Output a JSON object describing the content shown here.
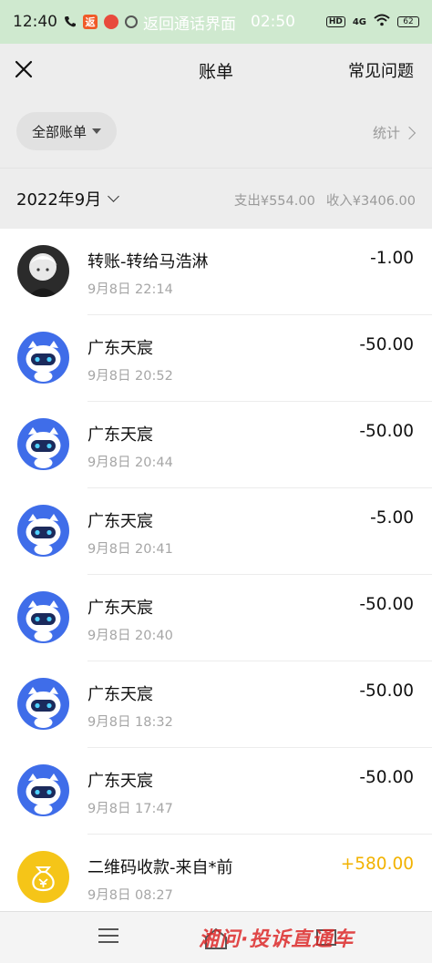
{
  "status_bar": {
    "time": "12:40",
    "call_back_text": "返回通话界面",
    "call_duration": "02:50",
    "app_badge": "返",
    "hd_label": "HD",
    "network": "4G",
    "battery": "62"
  },
  "header": {
    "title": "账单",
    "faq_label": "常见问题"
  },
  "filter": {
    "all_bills_label": "全部账单",
    "stats_label": "统计"
  },
  "month": {
    "label": "2022年9月",
    "expense": "支出¥554.00",
    "income": "收入¥3406.00"
  },
  "transactions": [
    {
      "name": "转账-转给马浩淋",
      "time": "9月8日 22:14",
      "amount": "-1.00",
      "avatar": "person-avatar",
      "type": "expense"
    },
    {
      "name": "广东天宸",
      "time": "9月8日 20:52",
      "amount": "-50.00",
      "avatar": "robot-avatar",
      "type": "expense"
    },
    {
      "name": "广东天宸",
      "time": "9月8日 20:44",
      "amount": "-50.00",
      "avatar": "robot-avatar",
      "type": "expense"
    },
    {
      "name": "广东天宸",
      "time": "9月8日 20:41",
      "amount": "-5.00",
      "avatar": "robot-avatar",
      "type": "expense"
    },
    {
      "name": "广东天宸",
      "time": "9月8日 20:40",
      "amount": "-50.00",
      "avatar": "robot-avatar",
      "type": "expense"
    },
    {
      "name": "广东天宸",
      "time": "9月8日 18:32",
      "amount": "-50.00",
      "avatar": "robot-avatar",
      "type": "expense"
    },
    {
      "name": "广东天宸",
      "time": "9月8日 17:47",
      "amount": "-50.00",
      "avatar": "robot-avatar",
      "type": "expense"
    },
    {
      "name": "二维码收款-来自*前",
      "time": "9月8日 08:27",
      "amount": "+580.00",
      "avatar": "coin-bag-avatar",
      "type": "income"
    }
  ],
  "watermark": "湘问·投诉直通车",
  "colors": {
    "status_bar_bg": "#cfe9cf",
    "income": "#f2b200",
    "robot_blue": "#3f6de9"
  }
}
